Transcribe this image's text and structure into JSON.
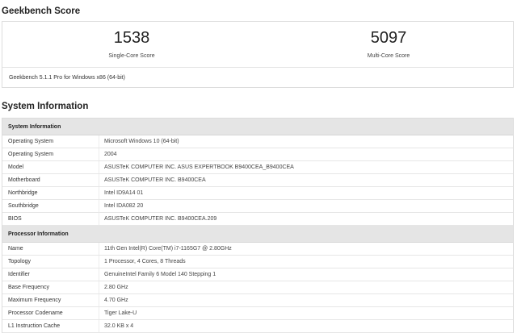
{
  "score": {
    "heading": "Geekbench Score",
    "single_core": {
      "value": "1538",
      "label": "Single-Core Score"
    },
    "multi_core": {
      "value": "5097",
      "label": "Multi-Core Score"
    },
    "version": "Geekbench 5.1.1 Pro for Windows x86 (64-bit)"
  },
  "system_information": {
    "heading": "System Information",
    "groups": [
      {
        "title": "System Information",
        "rows": [
          {
            "key": "Operating System",
            "value": "Microsoft Windows 10 (64-bit)"
          },
          {
            "key": "Operating System",
            "value": "2004"
          },
          {
            "key": "Model",
            "value": "ASUSTeK COMPUTER INC. ASUS EXPERTBOOK B9400CEA_B9400CEA"
          },
          {
            "key": "Motherboard",
            "value": "ASUSTeK COMPUTER INC. B9400CEA"
          },
          {
            "key": "Northbridge",
            "value": "Intel ID9A14 01"
          },
          {
            "key": "Southbridge",
            "value": "Intel IDA082 20"
          },
          {
            "key": "BIOS",
            "value": "ASUSTeK COMPUTER INC. B9400CEA.209"
          }
        ]
      },
      {
        "title": "Processor Information",
        "rows": [
          {
            "key": "Name",
            "value": "11th Gen Intel(R) Core(TM) i7-1165G7 @ 2.80GHz"
          },
          {
            "key": "Topology",
            "value": "1 Processor, 4 Cores, 8 Threads"
          },
          {
            "key": "Identifier",
            "value": "GenuineIntel Family 6 Model 140 Stepping 1"
          },
          {
            "key": "Base Frequency",
            "value": "2.80 GHz"
          },
          {
            "key": "Maximum Frequency",
            "value": "4.70 GHz"
          },
          {
            "key": "Processor Codename",
            "value": "Tiger Lake-U"
          },
          {
            "key": "L1 Instruction Cache",
            "value": "32.0 KB x 4"
          }
        ]
      }
    ]
  }
}
